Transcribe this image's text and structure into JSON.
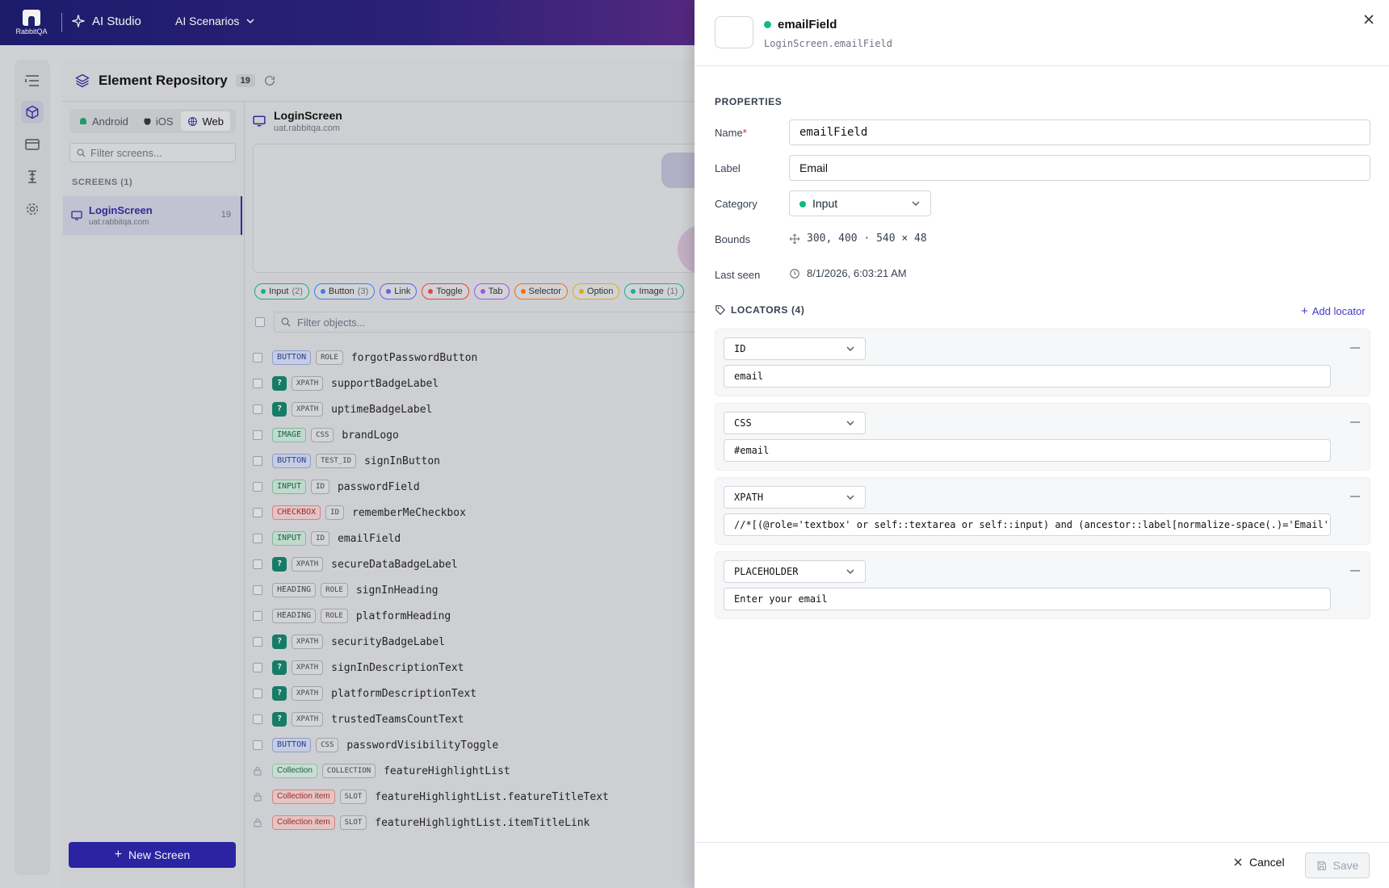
{
  "topbar": {
    "logo_text": "RabbitQA",
    "ai_studio": "AI Studio",
    "ai_scenarios": "AI Scenarios"
  },
  "repo": {
    "title": "Element Repository",
    "count": "19",
    "platforms": [
      "Android",
      "iOS",
      "Web"
    ],
    "active_platform": "Web",
    "filter_screens_placeholder": "Filter screens...",
    "screens_header": "SCREENS (1)",
    "screen": {
      "name": "LoginScreen",
      "url": "uat.rabbitqa.com",
      "count": "19"
    },
    "new_screen": "New Screen"
  },
  "selected_screen": {
    "name": "LoginScreen",
    "url": "uat.rabbitqa.com"
  },
  "category_chips": [
    {
      "label": "Input",
      "count": "(2)",
      "color": "#10b981"
    },
    {
      "label": "Button",
      "count": "(3)",
      "color": "#3b82f6"
    },
    {
      "label": "Link",
      "count": "",
      "color": "#6366f1"
    },
    {
      "label": "Toggle",
      "count": "",
      "color": "#ef4444"
    },
    {
      "label": "Tab",
      "count": "",
      "color": "#a855f7"
    },
    {
      "label": "Selector",
      "count": "",
      "color": "#f97316"
    },
    {
      "label": "Option",
      "count": "",
      "color": "#eab308"
    },
    {
      "label": "Image",
      "count": "(1)",
      "color": "#14b8a6"
    }
  ],
  "filter_objects_placeholder": "Filter objects...",
  "objects": [
    {
      "cat": "BUTTON",
      "loc": "ROLE",
      "name": "forgotPasswordButton",
      "kind": "button"
    },
    {
      "cat": "?",
      "loc": "XPATH",
      "name": "supportBadgeLabel",
      "kind": "q"
    },
    {
      "cat": "?",
      "loc": "XPATH",
      "name": "uptimeBadgeLabel",
      "kind": "q"
    },
    {
      "cat": "IMAGE",
      "loc": "CSS",
      "name": "brandLogo",
      "kind": "image"
    },
    {
      "cat": "BUTTON",
      "loc": "TEST_ID",
      "name": "signInButton",
      "kind": "button"
    },
    {
      "cat": "INPUT",
      "loc": "ID",
      "name": "passwordField",
      "kind": "input"
    },
    {
      "cat": "CHECKBOX",
      "loc": "ID",
      "name": "rememberMeCheckbox",
      "kind": "checkbox"
    },
    {
      "cat": "INPUT",
      "loc": "ID",
      "name": "emailField",
      "kind": "input"
    },
    {
      "cat": "?",
      "loc": "XPATH",
      "name": "secureDataBadgeLabel",
      "kind": "q"
    },
    {
      "cat": "HEADING",
      "loc": "ROLE",
      "name": "signInHeading",
      "kind": "heading"
    },
    {
      "cat": "HEADING",
      "loc": "ROLE",
      "name": "platformHeading",
      "kind": "heading"
    },
    {
      "cat": "?",
      "loc": "XPATH",
      "name": "securityBadgeLabel",
      "kind": "q"
    },
    {
      "cat": "?",
      "loc": "XPATH",
      "name": "signInDescriptionText",
      "kind": "q"
    },
    {
      "cat": "?",
      "loc": "XPATH",
      "name": "platformDescriptionText",
      "kind": "q"
    },
    {
      "cat": "?",
      "loc": "XPATH",
      "name": "trustedTeamsCountText",
      "kind": "q"
    },
    {
      "cat": "BUTTON",
      "loc": "CSS",
      "name": "passwordVisibilityToggle",
      "kind": "button"
    },
    {
      "cat": "Collection",
      "loc": "COLLECTION",
      "name": "featureHighlightList",
      "kind": "collection",
      "locked": true
    },
    {
      "cat": "Collection item",
      "loc": "SLOT",
      "name": "featureHighlightList.featureTitleText",
      "kind": "collection-item",
      "locked": true
    },
    {
      "cat": "Collection item",
      "loc": "SLOT",
      "name": "featureHighlightList.itemTitleLink",
      "kind": "collection-item",
      "locked": true
    }
  ],
  "drawer": {
    "element_name": "emailField",
    "element_path": "LoginScreen.emailField",
    "properties_header": "PROPERTIES",
    "name_label": "Name",
    "name_required": "*",
    "name_value": "emailField",
    "label_label": "Label",
    "label_value": "Email",
    "category_label": "Category",
    "category_value": "Input",
    "bounds_label": "Bounds",
    "bounds_value": "300, 400 · 540 × 48",
    "last_seen_label": "Last seen",
    "last_seen_value": "8/1/2026, 6:03:21 AM",
    "locators_header": "LOCATORS (4)",
    "add_locator": "Add locator",
    "locators": [
      {
        "type": "ID",
        "value": "email"
      },
      {
        "type": "CSS",
        "value": "#email"
      },
      {
        "type": "XPATH",
        "value": "//*[(@role='textbox' or self::textarea or self::input) and (ancestor::label[normalize-space(.)='Email']"
      },
      {
        "type": "PLACEHOLDER",
        "value": "Enter your email"
      }
    ],
    "cancel": "Cancel",
    "save": "Save"
  },
  "colors": {
    "accent": "#2a23a8",
    "status_green": "#10b981",
    "link": "#4338ca"
  }
}
